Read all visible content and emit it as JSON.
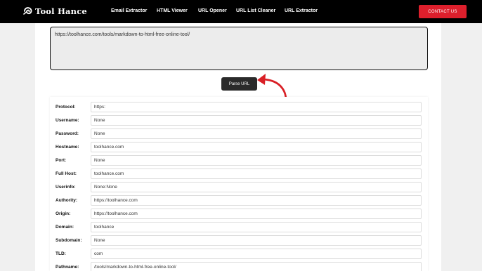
{
  "brand": {
    "name": "Tool Hance",
    "logo_icon": "swirl-logo-icon"
  },
  "nav": {
    "links": [
      "Email Extractor",
      "HTML Viewer",
      "URL Opener",
      "URL List Cleaner",
      "URL Extractor"
    ],
    "contact_label": "CONTACT US"
  },
  "input": {
    "url": "https://toolhance.com/tools/markdown-to-html-free-online-tool/"
  },
  "parse_button": {
    "label": "Parse URL"
  },
  "colors": {
    "accent": "#dd1f2c",
    "nav_bg": "#000000",
    "button_bg": "#2a2a2a"
  },
  "results": [
    {
      "label": "Protocol:",
      "value": "https:"
    },
    {
      "label": "Username:",
      "value": "None"
    },
    {
      "label": "Password:",
      "value": "None"
    },
    {
      "label": "Hostname:",
      "value": "toolhance.com"
    },
    {
      "label": "Port:",
      "value": "None"
    },
    {
      "label": "Full Host:",
      "value": "toolhance.com"
    },
    {
      "label": "Userinfo:",
      "value": "None:None"
    },
    {
      "label": "Authority:",
      "value": "https://toolhance.com"
    },
    {
      "label": "Origin:",
      "value": "https://toolhance.com"
    },
    {
      "label": "Domain:",
      "value": "toolhance"
    },
    {
      "label": "Subdomain:",
      "value": "None"
    },
    {
      "label": "TLD:",
      "value": "com"
    },
    {
      "label": "Pathname:",
      "value": "/tools/markdown-to-html-free-online-tool/"
    }
  ]
}
